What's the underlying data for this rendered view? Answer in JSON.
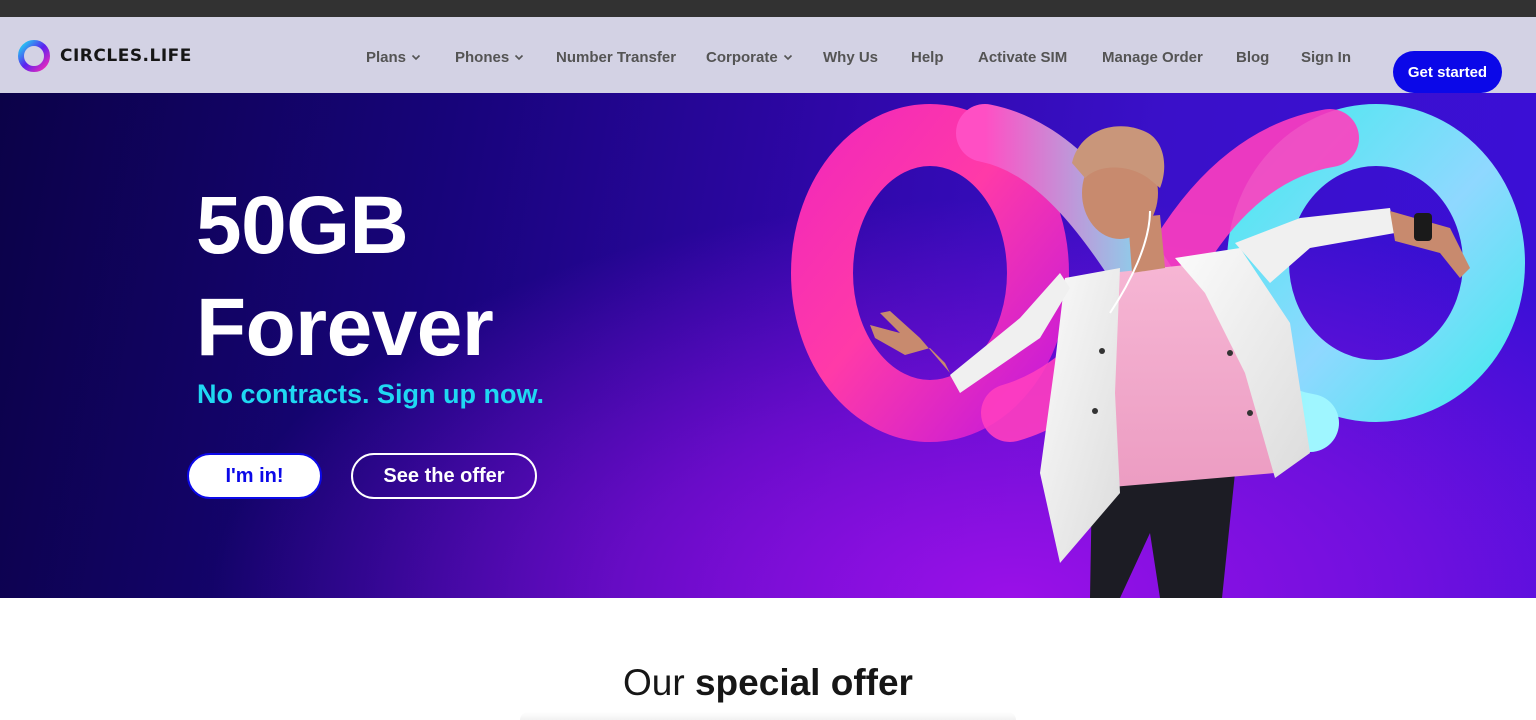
{
  "brand": {
    "name": "CIRCLES.LIFE",
    "logo_colors": [
      "#5a22f0",
      "#1fd8f2",
      "#f32ab8"
    ]
  },
  "nav": {
    "items": [
      {
        "label": "Plans",
        "has_dropdown": true
      },
      {
        "label": "Phones",
        "has_dropdown": true
      },
      {
        "label": "Number Transfer",
        "has_dropdown": false
      },
      {
        "label": "Corporate",
        "has_dropdown": true
      },
      {
        "label": "Why Us",
        "has_dropdown": false
      },
      {
        "label": "Help",
        "has_dropdown": false
      },
      {
        "label": "Activate SIM",
        "has_dropdown": false
      },
      {
        "label": "Manage Order",
        "has_dropdown": false
      },
      {
        "label": "Blog",
        "has_dropdown": false
      },
      {
        "label": "Sign In",
        "has_dropdown": false
      }
    ],
    "cta_label": "Get started"
  },
  "hero": {
    "headline_line1": "50GB",
    "headline_line2": "Forever",
    "subhead": "No contracts. Sign up now.",
    "primary_button": "I'm in!",
    "secondary_button": "See the offer",
    "image_icon": "infinity-symbol-with-dancing-person"
  },
  "section": {
    "title_light": "Our",
    "title_bold": "special offer"
  },
  "colors": {
    "accent_blue": "#0b08e8",
    "subhead_cyan": "#1fd8f2",
    "hero_dark": "#0b0248",
    "hero_purple": "#3b0fd8",
    "infinity_pink": "#f32ab8",
    "infinity_cyan": "#4ee8f0"
  }
}
